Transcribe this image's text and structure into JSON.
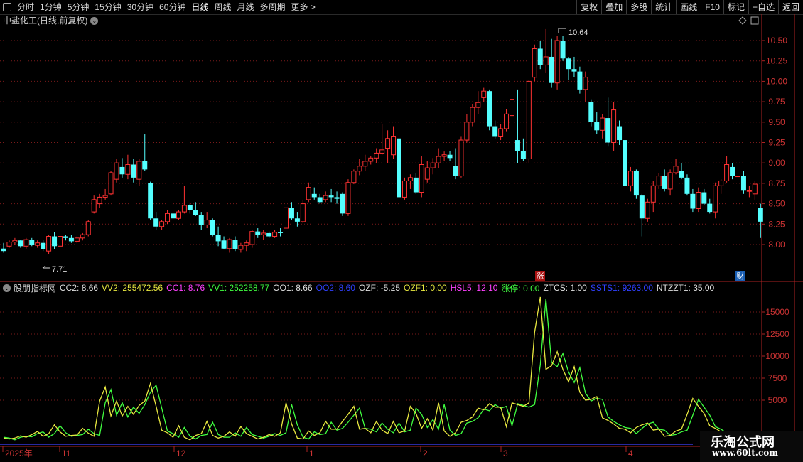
{
  "toolbar": {
    "periods": [
      "分时",
      "1分钟",
      "5分钟",
      "15分钟",
      "30分钟",
      "60分钟",
      "日线",
      "周线",
      "月线",
      "多周期",
      "更多 >"
    ],
    "active_period": "日线",
    "actions": [
      "复权",
      "叠加",
      "多股",
      "统计",
      "画线",
      "F10",
      "标记",
      "+自选",
      "返回"
    ]
  },
  "chart_title": "中盐化工(日线,前复权)",
  "price_axis": {
    "labels": [
      "10.50",
      "10.25",
      "10.00",
      "9.75",
      "9.50",
      "9.25",
      "9.00",
      "8.75",
      "8.50",
      "8.25",
      "8.00"
    ]
  },
  "annotations": {
    "high_label": "10.64",
    "low_label": "7.71",
    "zhang_tag": "涨",
    "cai_tag": "财"
  },
  "indicator": {
    "name": "股朋指标网",
    "items": [
      {
        "text": "CC2: 8.66",
        "color": "#e0e0e0"
      },
      {
        "text": "VV2: 255472.56",
        "color": "#e8e840"
      },
      {
        "text": "CC1: 8.76",
        "color": "#ff40ff"
      },
      {
        "text": "VV1: 252258.77",
        "color": "#40ff40"
      },
      {
        "text": "OO1: 8.66",
        "color": "#e0e0e0"
      },
      {
        "text": "OO2: 8.60",
        "color": "#3040ff"
      },
      {
        "text": "OZF: -5.25",
        "color": "#e0e0e0"
      },
      {
        "text": "OZF1: 0.00",
        "color": "#e8e840"
      },
      {
        "text": "HSL5: 12.10",
        "color": "#ff40ff"
      },
      {
        "text": "涨停: 0.00",
        "color": "#40ff40"
      },
      {
        "text": "ZTCS: 1.00",
        "color": "#e0e0e0"
      },
      {
        "text": "SSTS1: 9263.00",
        "color": "#3040ff"
      },
      {
        "text": "NTZZT1: 35.00",
        "color": "#e0e0e0"
      }
    ]
  },
  "indicator_axis": {
    "labels": [
      "15000",
      "12500",
      "10000",
      "7500",
      "5000"
    ]
  },
  "date_axis": {
    "labels": [
      "2025年",
      "11",
      "12",
      "1",
      "2",
      "3",
      "4"
    ]
  },
  "watermark": {
    "line1": "乐淘公式网",
    "line2": "www.60lt.com"
  },
  "chart_data": {
    "type": "candlestick",
    "price_ylim": [
      7.6,
      10.8
    ],
    "candles": [
      [
        7.95,
        8.02,
        7.9,
        7.92
      ],
      [
        7.98,
        8.05,
        7.96,
        8.03
      ],
      [
        8.03,
        8.08,
        8.0,
        8.05
      ],
      [
        8.05,
        8.06,
        7.96,
        7.98
      ],
      [
        7.98,
        8.08,
        7.95,
        8.06
      ],
      [
        8.06,
        8.08,
        7.98,
        8.0
      ],
      [
        7.99,
        8.05,
        7.96,
        8.02
      ],
      [
        8.02,
        8.06,
        7.92,
        7.94
      ],
      [
        7.92,
        8.12,
        7.88,
        8.1
      ],
      [
        8.1,
        8.15,
        7.94,
        7.98
      ],
      [
        7.98,
        8.12,
        7.96,
        8.1
      ],
      [
        8.1,
        8.12,
        8.05,
        8.08
      ],
      [
        8.08,
        8.12,
        8.02,
        8.04
      ],
      [
        8.04,
        8.1,
        8.02,
        8.08
      ],
      [
        8.08,
        8.14,
        8.05,
        8.12
      ],
      [
        8.12,
        8.3,
        8.1,
        8.28
      ],
      [
        8.4,
        8.6,
        8.38,
        8.55
      ],
      [
        8.5,
        8.62,
        8.45,
        8.58
      ],
      [
        8.58,
        8.68,
        8.55,
        8.6
      ],
      [
        8.62,
        8.9,
        8.6,
        8.88
      ],
      [
        8.8,
        9.05,
        8.76,
        9.0
      ],
      [
        8.95,
        9.06,
        8.82,
        8.86
      ],
      [
        8.86,
        9.1,
        8.8,
        8.98
      ],
      [
        8.98,
        9.05,
        8.76,
        8.82
      ],
      [
        8.8,
        9.05,
        8.72,
        9.02
      ],
      [
        9.02,
        9.35,
        8.9,
        8.92
      ],
      [
        8.75,
        8.77,
        8.3,
        8.32
      ],
      [
        8.32,
        8.4,
        8.18,
        8.22
      ],
      [
        8.22,
        8.3,
        8.18,
        8.28
      ],
      [
        8.28,
        8.42,
        8.25,
        8.38
      ],
      [
        8.38,
        8.45,
        8.3,
        8.32
      ],
      [
        8.32,
        8.42,
        8.3,
        8.4
      ],
      [
        8.4,
        8.72,
        8.38,
        8.48
      ],
      [
        8.48,
        8.5,
        8.38,
        8.42
      ],
      [
        8.42,
        8.52,
        8.35,
        8.36
      ],
      [
        8.36,
        8.4,
        8.18,
        8.24
      ],
      [
        8.24,
        8.4,
        8.2,
        8.3
      ],
      [
        8.3,
        8.32,
        8.1,
        8.12
      ],
      [
        8.12,
        8.22,
        7.98,
        8.04
      ],
      [
        8.05,
        8.1,
        7.94,
        7.95
      ],
      [
        7.95,
        8.08,
        7.9,
        8.06
      ],
      [
        8.06,
        8.1,
        7.92,
        7.94
      ],
      [
        7.94,
        8.02,
        7.9,
        7.99
      ],
      [
        7.99,
        8.05,
        7.92,
        8.02
      ],
      [
        8.0,
        8.18,
        7.96,
        8.16
      ],
      [
        8.16,
        8.2,
        8.08,
        8.12
      ],
      [
        8.12,
        8.18,
        8.06,
        8.14
      ],
      [
        8.14,
        8.16,
        8.08,
        8.1
      ],
      [
        8.1,
        8.18,
        8.08,
        8.15
      ],
      [
        8.15,
        8.2,
        8.1,
        8.14
      ],
      [
        8.2,
        8.5,
        8.18,
        8.45
      ],
      [
        8.45,
        8.52,
        8.3,
        8.32
      ],
      [
        8.32,
        8.4,
        8.22,
        8.28
      ],
      [
        8.28,
        8.55,
        8.26,
        8.5
      ],
      [
        8.55,
        8.76,
        8.52,
        8.7
      ],
      [
        8.62,
        8.7,
        8.55,
        8.58
      ],
      [
        8.58,
        8.62,
        8.5,
        8.52
      ],
      [
        8.55,
        8.65,
        8.52,
        8.6
      ],
      [
        8.6,
        8.68,
        8.52,
        8.58
      ],
      [
        8.58,
        8.65,
        8.5,
        8.56
      ],
      [
        8.62,
        8.64,
        8.35,
        8.38
      ],
      [
        8.38,
        8.8,
        8.35,
        8.76
      ],
      [
        8.76,
        8.92,
        8.74,
        8.9
      ],
      [
        8.9,
        9.05,
        8.85,
        8.96
      ],
      [
        8.96,
        9.1,
        8.9,
        9.02
      ],
      [
        9.02,
        9.08,
        8.98,
        9.06
      ],
      [
        9.06,
        9.18,
        9.0,
        9.12
      ],
      [
        9.12,
        9.48,
        9.1,
        9.16
      ],
      [
        9.18,
        9.4,
        9.0,
        9.3
      ],
      [
        9.1,
        9.45,
        9.05,
        9.32
      ],
      [
        9.3,
        9.38,
        8.56,
        8.58
      ],
      [
        8.58,
        8.82,
        8.55,
        8.78
      ],
      [
        8.78,
        8.86,
        8.68,
        8.82
      ],
      [
        8.82,
        8.88,
        8.62,
        8.64
      ],
      [
        8.64,
        9.08,
        8.58,
        8.98
      ],
      [
        8.8,
        9.02,
        8.76,
        8.94
      ],
      [
        8.94,
        9.06,
        8.86,
        9.0
      ],
      [
        9.0,
        9.18,
        8.94,
        9.08
      ],
      [
        9.08,
        9.14,
        9.02,
        9.1
      ],
      [
        9.1,
        9.15,
        9.02,
        9.06
      ],
      [
        8.96,
        9.18,
        8.8,
        8.84
      ],
      [
        8.84,
        9.32,
        8.82,
        9.28
      ],
      [
        9.28,
        9.6,
        9.25,
        9.5
      ],
      [
        9.5,
        9.72,
        9.45,
        9.68
      ],
      [
        9.68,
        9.88,
        9.6,
        9.74
      ],
      [
        9.8,
        9.92,
        9.75,
        9.88
      ],
      [
        9.88,
        9.9,
        9.4,
        9.45
      ],
      [
        9.45,
        9.52,
        9.3,
        9.32
      ],
      [
        9.32,
        9.48,
        9.28,
        9.42
      ],
      [
        9.42,
        9.66,
        9.38,
        9.6
      ],
      [
        9.58,
        9.82,
        9.55,
        9.78
      ],
      [
        9.28,
        9.9,
        9.0,
        9.15
      ],
      [
        9.15,
        9.3,
        9.02,
        9.05
      ],
      [
        9.05,
        10.02,
        9.0,
        10.0
      ],
      [
        10.05,
        10.45,
        10.0,
        10.4
      ],
      [
        10.4,
        10.5,
        10.15,
        10.2
      ],
      [
        10.2,
        10.64,
        10.1,
        10.3
      ],
      [
        10.3,
        10.52,
        9.92,
        9.98
      ],
      [
        9.98,
        10.56,
        9.9,
        10.5
      ],
      [
        10.5,
        10.56,
        10.25,
        10.28
      ],
      [
        10.28,
        10.3,
        10.02,
        10.15
      ],
      [
        10.15,
        10.3,
        10.05,
        10.12
      ],
      [
        10.12,
        10.18,
        9.85,
        9.9
      ],
      [
        9.9,
        10.12,
        9.75,
        10.05
      ],
      [
        9.75,
        9.78,
        9.45,
        9.5
      ],
      [
        9.5,
        9.62,
        9.35,
        9.4
      ],
      [
        9.4,
        9.6,
        9.3,
        9.55
      ],
      [
        9.55,
        9.8,
        9.2,
        9.25
      ],
      [
        9.25,
        9.75,
        9.15,
        9.65
      ],
      [
        9.45,
        9.52,
        9.22,
        9.28
      ],
      [
        9.28,
        9.35,
        8.7,
        8.72
      ],
      [
        8.72,
        8.95,
        8.65,
        8.9
      ],
      [
        8.9,
        8.92,
        8.56,
        8.6
      ],
      [
        8.6,
        8.62,
        8.1,
        8.32
      ],
      [
        8.32,
        8.56,
        8.28,
        8.52
      ],
      [
        8.52,
        8.78,
        8.4,
        8.72
      ],
      [
        8.72,
        8.88,
        8.68,
        8.84
      ],
      [
        8.84,
        8.92,
        8.65,
        8.68
      ],
      [
        8.68,
        8.92,
        8.6,
        8.88
      ],
      [
        8.88,
        9.05,
        8.86,
        8.96
      ],
      [
        8.9,
        9.0,
        8.8,
        8.82
      ],
      [
        8.82,
        8.86,
        8.6,
        8.62
      ],
      [
        8.62,
        8.68,
        8.4,
        8.44
      ],
      [
        8.44,
        8.7,
        8.4,
        8.64
      ],
      [
        8.64,
        8.68,
        8.48,
        8.5
      ],
      [
        8.5,
        8.56,
        8.38,
        8.4
      ],
      [
        8.4,
        8.76,
        8.32,
        8.72
      ],
      [
        8.72,
        8.8,
        8.62,
        8.78
      ],
      [
        8.78,
        9.08,
        8.76,
        8.98
      ],
      [
        8.95,
        9.0,
        8.8,
        8.84
      ],
      [
        8.84,
        8.9,
        8.72,
        8.84
      ],
      [
        8.84,
        8.9,
        8.62,
        8.66
      ],
      [
        8.66,
        8.72,
        8.58,
        8.66
      ],
      [
        8.62,
        8.78,
        8.55,
        8.74
      ],
      [
        8.45,
        8.5,
        8.08,
        8.28
      ]
    ],
    "vv2": [
      700,
      600,
      700,
      950,
      800,
      1100,
      1450,
      900,
      1200,
      2200,
      1400,
      900,
      1000,
      1050,
      1800,
      1250,
      900,
      4900,
      6500,
      3200,
      4900,
      3200,
      4300,
      3400,
      4400,
      4900,
      6900,
      4300,
      1600,
      1300,
      800,
      2100,
      800,
      500,
      1000,
      1200,
      2600,
      1000,
      700,
      900,
      1400,
      900,
      2000,
      1200,
      900,
      600,
      800,
      1100,
      900,
      1300,
      4700,
      2300,
      700,
      600,
      1500,
      1000,
      1300,
      2600,
      1700,
      1700,
      2600,
      3400,
      4300,
      1700,
      1800,
      1300,
      2600,
      1600,
      1200,
      2600,
      1300,
      1500,
      4300,
      3500,
      1800,
      2900,
      1600,
      4700,
      1500,
      900,
      1300,
      2500,
      2700,
      3100,
      4100,
      3900,
      4600,
      4200,
      4200,
      2000,
      4700,
      4500,
      4300,
      4700,
      12700,
      16700,
      8500,
      8900,
      10500,
      8500,
      7100,
      8800,
      5900,
      5000,
      5100,
      5400,
      3000,
      2700,
      2300,
      1800,
      1700,
      1300,
      1900,
      2200,
      2400,
      1600,
      1700,
      900,
      1000,
      1500,
      1700,
      3400,
      5200,
      4300,
      3500,
      2100,
      1800,
      1400
    ],
    "vv1": [
      800,
      700,
      500,
      800,
      900,
      850,
      1200,
      1400,
      800,
      1200,
      2100,
      1300,
      900,
      1000,
      1100,
      1700,
      1200,
      1000,
      4700,
      6200,
      3300,
      4700,
      3100,
      4200,
      3500,
      4500,
      5900,
      6700,
      4100,
      1500,
      1200,
      800,
      1900,
      900,
      600,
      1000,
      1100,
      2500,
      1100,
      800,
      800,
      1300,
      900,
      1900,
      1100,
      900,
      700,
      900,
      1200,
      1000,
      1300,
      4500,
      2200,
      800,
      600,
      1400,
      1100,
      1200,
      2500,
      1600,
      1800,
      2500,
      3300,
      4100,
      1800,
      1700,
      1400,
      2400,
      1700,
      1300,
      2400,
      1400,
      1600,
      4100,
      3400,
      1900,
      2800,
      1700,
      4500,
      1600,
      1000,
      1200,
      2400,
      2600,
      3000,
      4000,
      3800,
      4500,
      4100,
      4300,
      2100,
      4600,
      4400,
      4200,
      4500,
      9000,
      16500,
      9300,
      8800,
      10300,
      8200,
      7000,
      8700,
      5800,
      4900,
      5200,
      5100,
      3100,
      2600,
      2200,
      1900,
      1800,
      1200,
      1800,
      2300,
      2500,
      1700,
      1600,
      1000,
      1100,
      1400,
      1600,
      3300,
      5100,
      4200,
      3300,
      2000,
      1700,
      1300
    ],
    "indicator_ylim": [
      0,
      18000
    ]
  }
}
